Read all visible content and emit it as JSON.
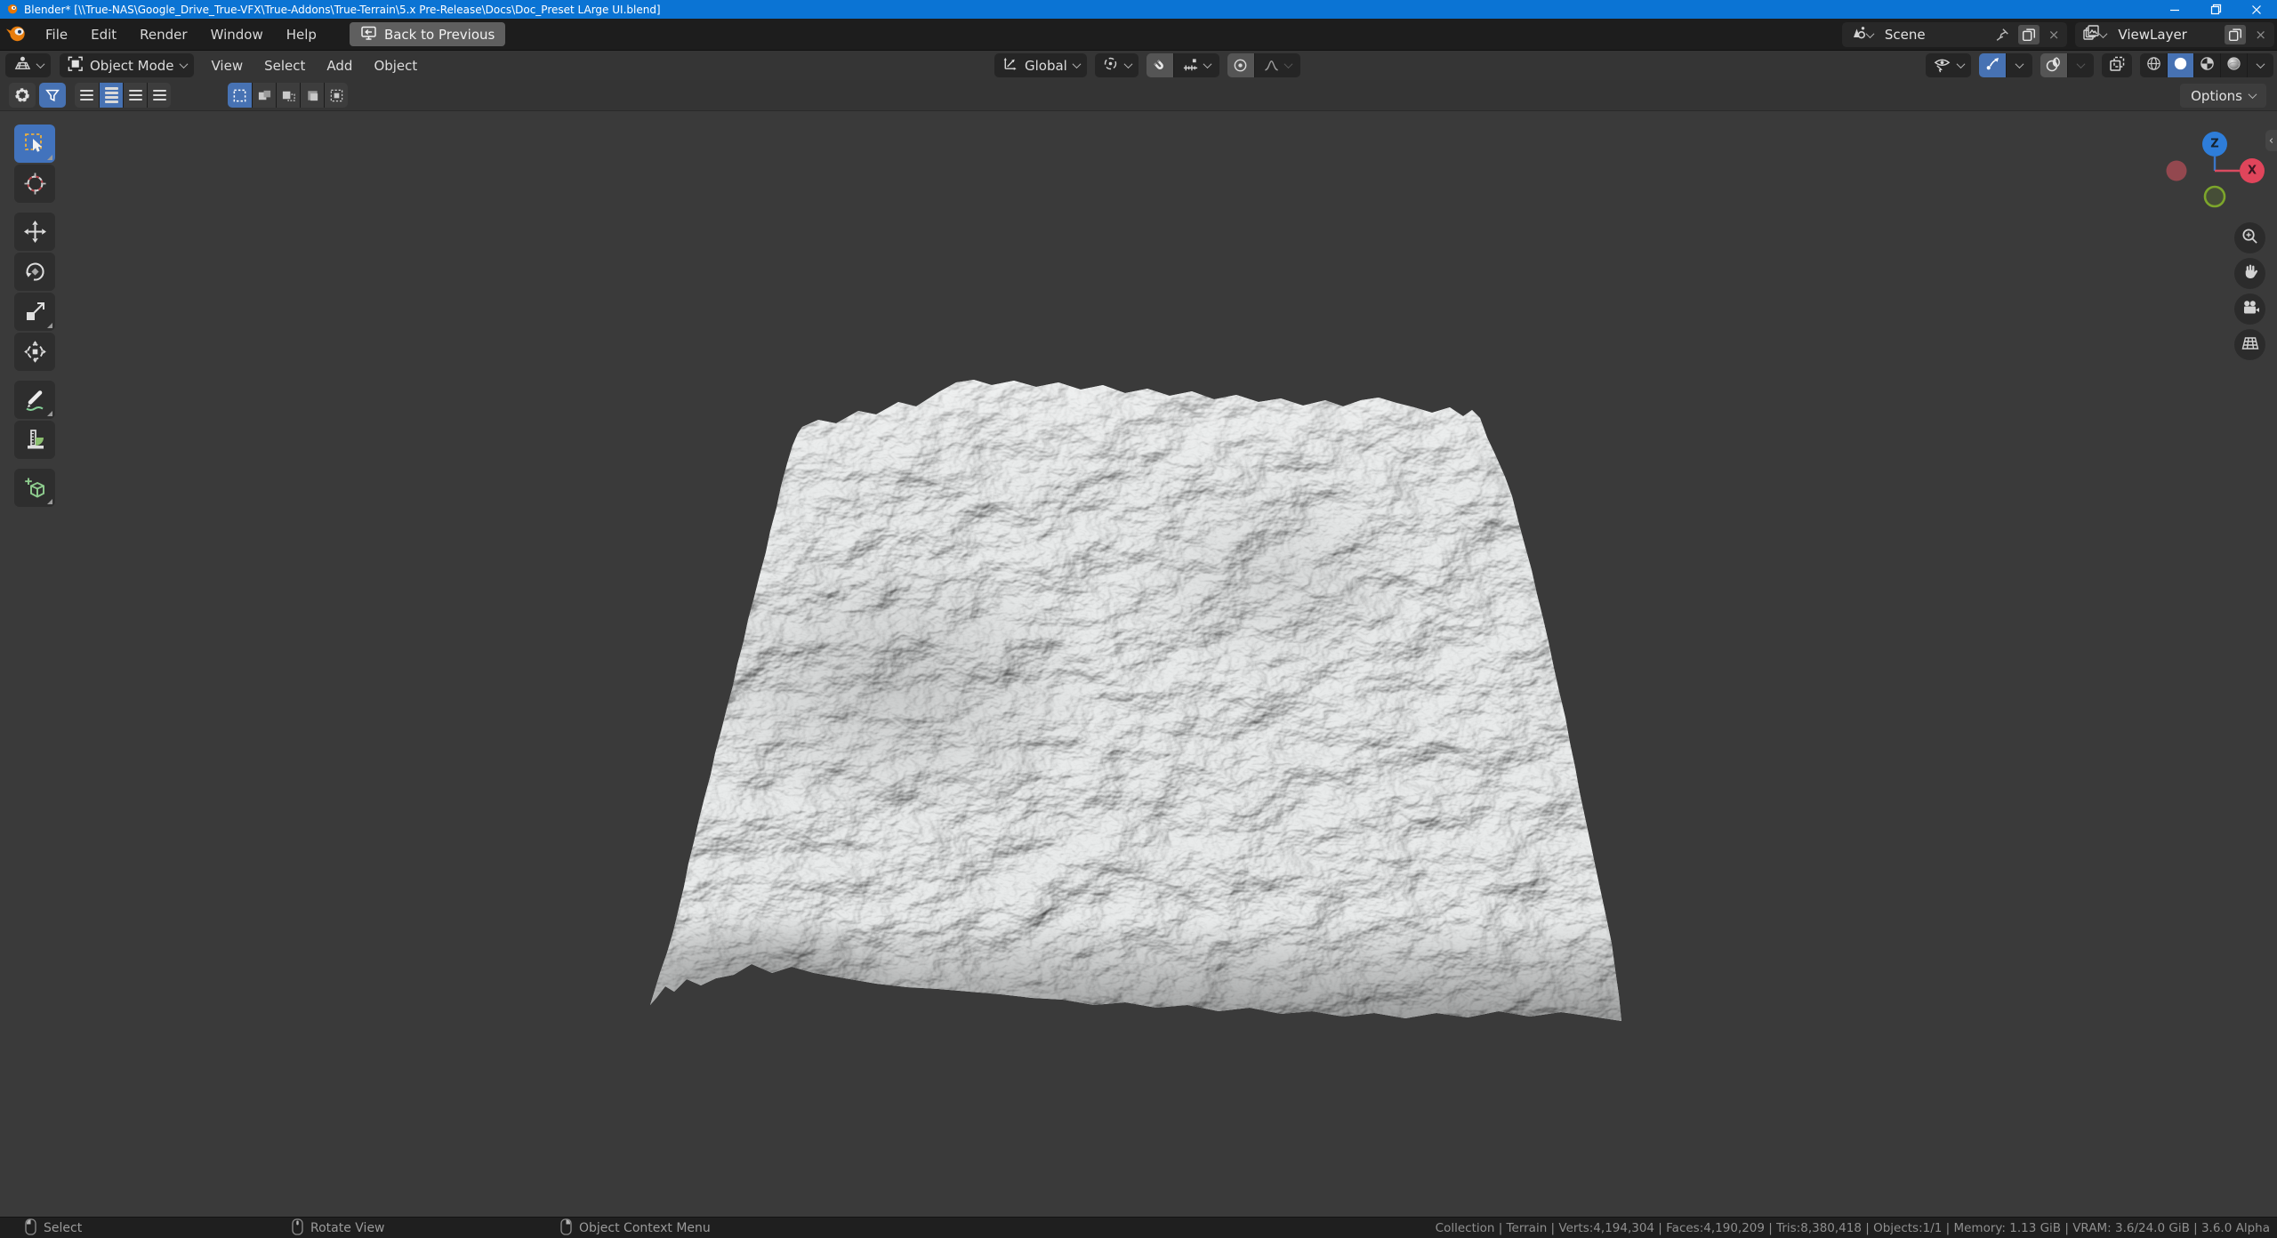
{
  "window": {
    "title": "Blender* [\\\\True-NAS\\Google_Drive_True-VFX\\True-Addons\\True-Terrain\\5.x Pre-Release\\Docs\\Doc_Preset LArge UI.blend]"
  },
  "topbar": {
    "menus": [
      "File",
      "Edit",
      "Render",
      "Window",
      "Help"
    ],
    "back_button_label": "Back to Previous",
    "scene_selector": {
      "value": "Scene"
    },
    "view_layer_selector": {
      "value": "ViewLayer"
    }
  },
  "header": {
    "mode_selector": "Object Mode",
    "menus": [
      "View",
      "Select",
      "Add",
      "Object"
    ],
    "orientation_selector": "Global"
  },
  "tool_settings": {
    "options_dropdown": "Options"
  },
  "viewport": {
    "gizmo": {
      "z_label": "Z",
      "x_label": "X"
    }
  },
  "statusbar": {
    "keymap_hints": [
      {
        "mouse_button": "left",
        "label": "Select"
      },
      {
        "mouse_button": "middle",
        "label": "Rotate View"
      },
      {
        "mouse_button": "right",
        "label": "Object Context Menu"
      }
    ],
    "scene_stats": "Collection | Terrain | Verts:4,194,304 | Faces:4,190,209 | Tris:8,380,418 | Objects:1/1 | Memory: 1.13 GiB | VRAM: 3.6/24.0 GiB | 3.6.0 Alpha"
  },
  "colors": {
    "titlebar_blue": "#0b74d4",
    "accent_blue": "#4772b3",
    "axis_x_red": "#e0455b",
    "axis_z_blue": "#2e7dd9",
    "axis_y_green": "#7da62b",
    "terrain_gray": "#c4c7c8",
    "viewport_bg": "#3a3a3a"
  }
}
